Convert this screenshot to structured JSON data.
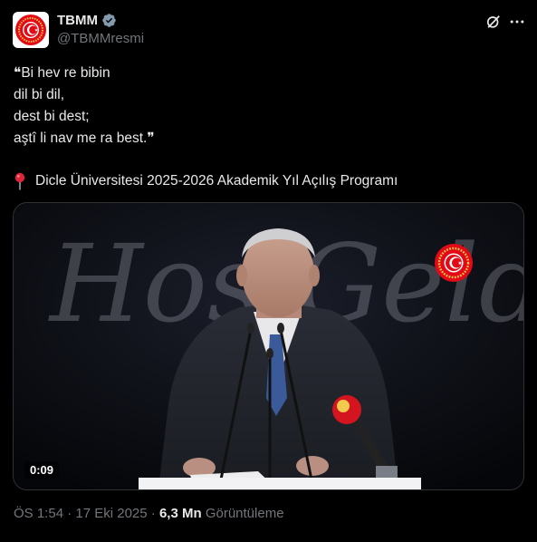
{
  "author": {
    "display_name": "TBMM",
    "handle": "@TBMMresmi",
    "verified_color": "#829aab"
  },
  "post": {
    "quote_lines": [
      "❝Bi hev re bibin",
      "dil bi dil,",
      "dest bi dest;",
      "aştî li nav me ra best.❞"
    ],
    "location_text": "Dicle Üniversitesi 2025-2026 Akademik Yıl Açılış Programı"
  },
  "media": {
    "background_text": "Hoş Geldiniz",
    "duration": "0:09"
  },
  "meta": {
    "time": "ÖS 1:54",
    "separator": "·",
    "date": "17 Eki 2025",
    "views_count": "6,3 Mn",
    "views_label": "Görüntüleme"
  },
  "colors": {
    "background": "#000000",
    "text_primary": "#e7e9ea",
    "text_secondary": "#71767b",
    "emblem_red": "#e30a17"
  }
}
